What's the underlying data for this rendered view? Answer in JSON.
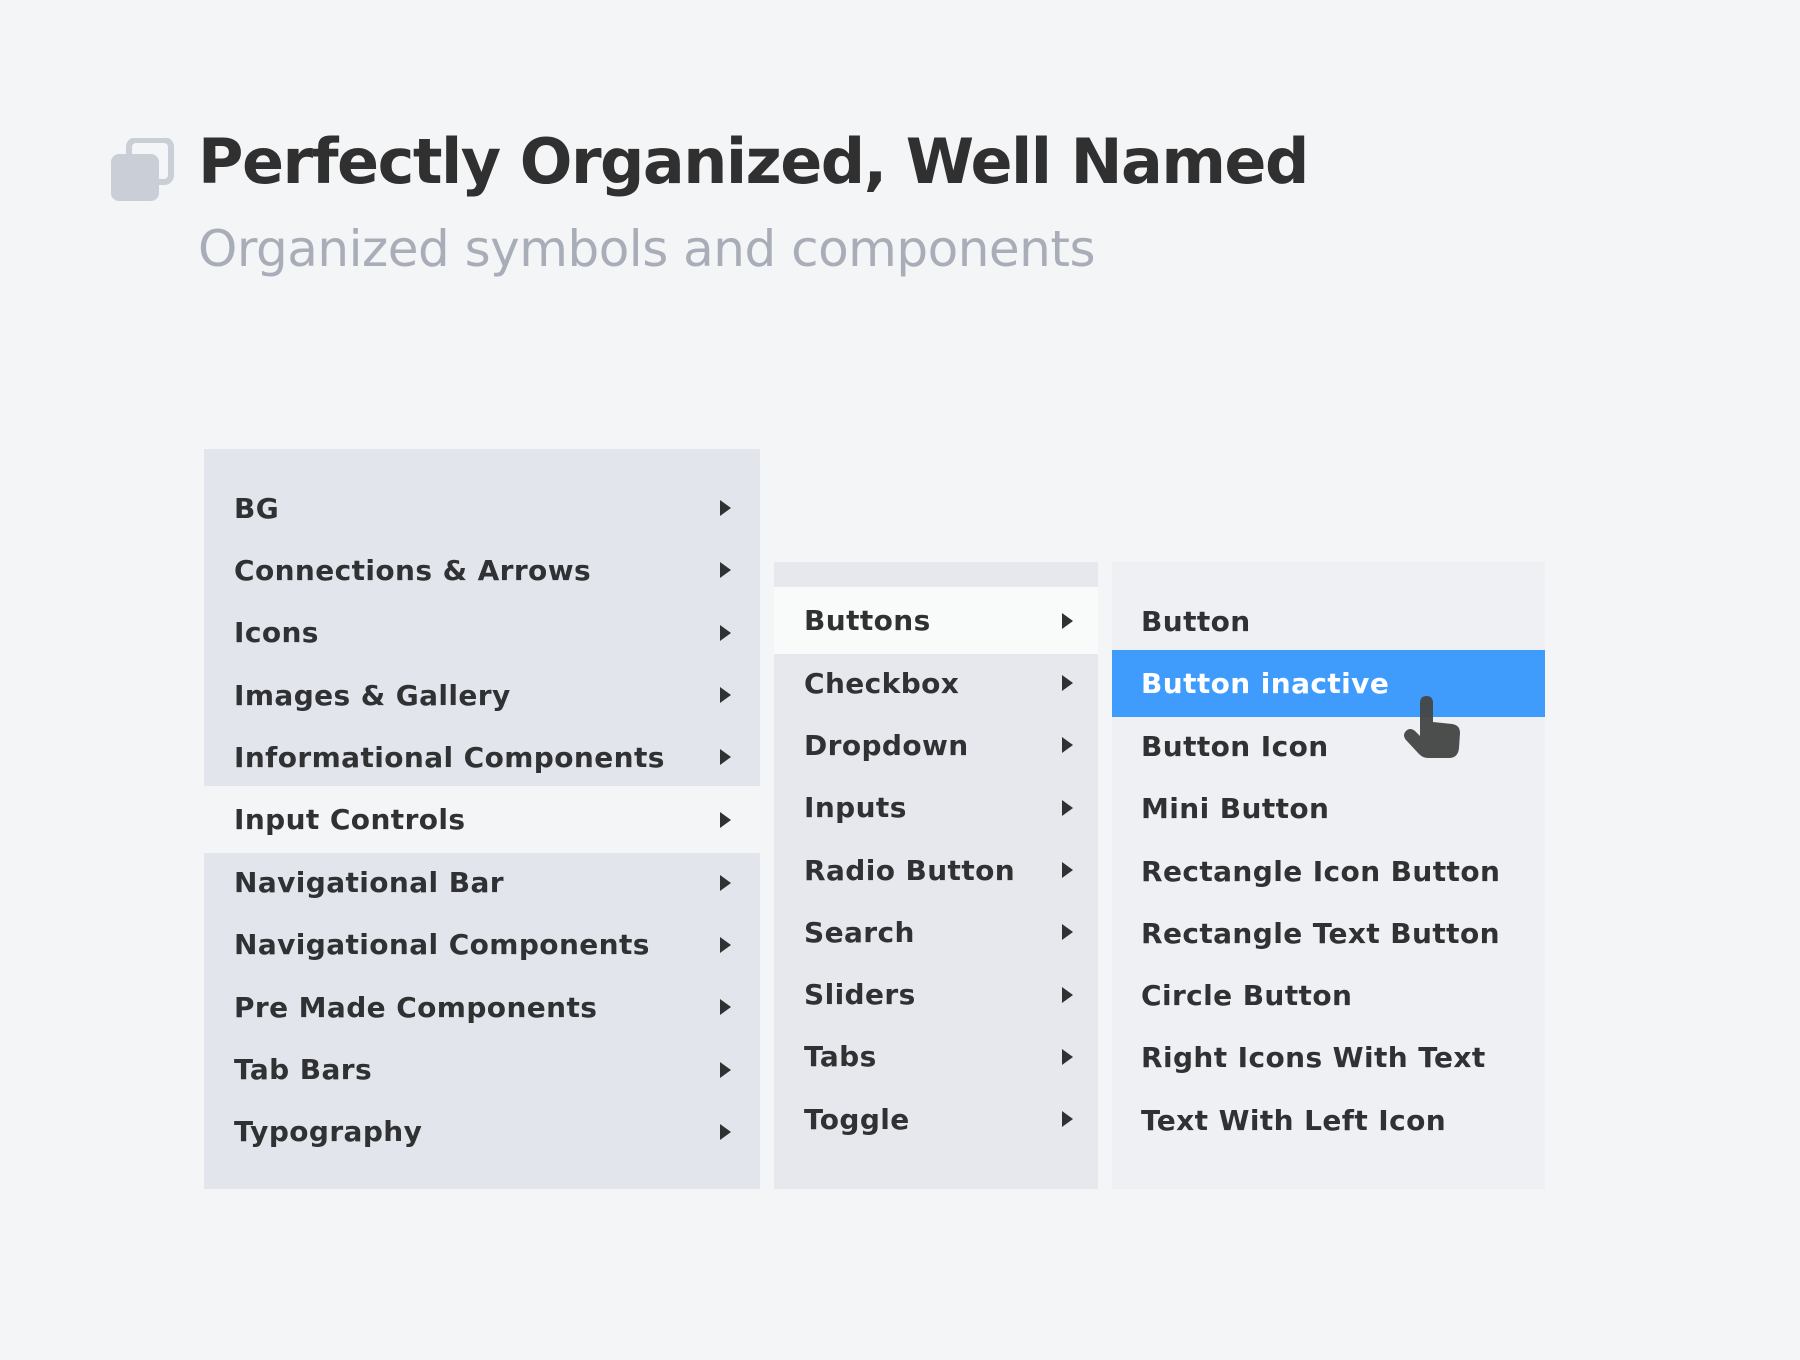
{
  "header": {
    "icon": "layers-copy-icon",
    "title": "Perfectly Organized, Well Named",
    "subtitle": "Organized symbols and components"
  },
  "colors": {
    "background": "#f4f5f7",
    "title": "#303030",
    "subtitle": "#a9adb7",
    "menu_level1": "#e2e5ec",
    "menu_level2": "#e6e8ed",
    "menu_level3": "#eff0f3",
    "selected": "#409cfc",
    "text": "#2f3133"
  },
  "menus": {
    "level1": {
      "active_index": 5,
      "items": [
        {
          "label": "BG",
          "has_submenu": true
        },
        {
          "label": "Connections & Arrows",
          "has_submenu": true
        },
        {
          "label": "Icons",
          "has_submenu": true
        },
        {
          "label": "Images & Gallery",
          "has_submenu": true
        },
        {
          "label": "Informational Components",
          "has_submenu": true
        },
        {
          "label": "Input Controls",
          "has_submenu": true
        },
        {
          "label": "Navigational Bar",
          "has_submenu": true
        },
        {
          "label": "Navigational Components",
          "has_submenu": true
        },
        {
          "label": "Pre Made Components",
          "has_submenu": true
        },
        {
          "label": "Tab Bars",
          "has_submenu": true
        },
        {
          "label": "Typography",
          "has_submenu": true
        }
      ]
    },
    "level2": {
      "active_index": 0,
      "items": [
        {
          "label": "Buttons",
          "has_submenu": true
        },
        {
          "label": "Checkbox",
          "has_submenu": true
        },
        {
          "label": "Dropdown",
          "has_submenu": true
        },
        {
          "label": "Inputs",
          "has_submenu": true
        },
        {
          "label": "Radio Button",
          "has_submenu": true
        },
        {
          "label": "Search",
          "has_submenu": true
        },
        {
          "label": "Sliders",
          "has_submenu": true
        },
        {
          "label": "Tabs",
          "has_submenu": true
        },
        {
          "label": "Toggle",
          "has_submenu": true
        }
      ]
    },
    "level3": {
      "selected_index": 1,
      "items": [
        {
          "label": "Button"
        },
        {
          "label": "Button inactive"
        },
        {
          "label": "Button Icon"
        },
        {
          "label": "Mini Button"
        },
        {
          "label": "Rectangle Icon Button"
        },
        {
          "label": "Rectangle Text Button"
        },
        {
          "label": "Circle Button"
        },
        {
          "label": "Right Icons With Text"
        },
        {
          "label": "Text With Left Icon"
        }
      ]
    }
  },
  "cursor": "hand-pointer-icon"
}
